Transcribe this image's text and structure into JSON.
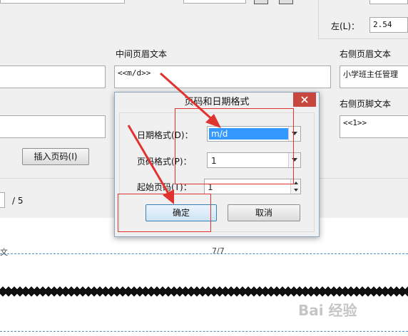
{
  "panel": {
    "left_label": "左(L)：",
    "left_value": "2.54",
    "center_header_label": "中间页眉文本",
    "center_header_value": "<<m/d>>",
    "right_header_label": "右侧页眉文本",
    "right_header_value": "小学班主任管理",
    "right_footer_label": "右侧页脚文本",
    "right_footer_value": "<<1>>",
    "insert_page_button": "插入页码(I)",
    "page_total": "/ 5"
  },
  "preview": {
    "left_text": "文",
    "center_text": "7/7"
  },
  "dialog": {
    "title": "页码和日期格式",
    "date_format_label": "日期格式(D)：",
    "date_format_value": "m/d",
    "page_format_label": "页码格式(P)：",
    "page_format_value": "1",
    "start_page_label": "起始页码(T)：",
    "start_page_value": "1",
    "ok_button": "确定",
    "cancel_button": "取消"
  },
  "watermark": "Bai 经验",
  "colors": {
    "close_button": "#c7463e",
    "selection": "#3399ff",
    "annotation": "#e0332f"
  }
}
